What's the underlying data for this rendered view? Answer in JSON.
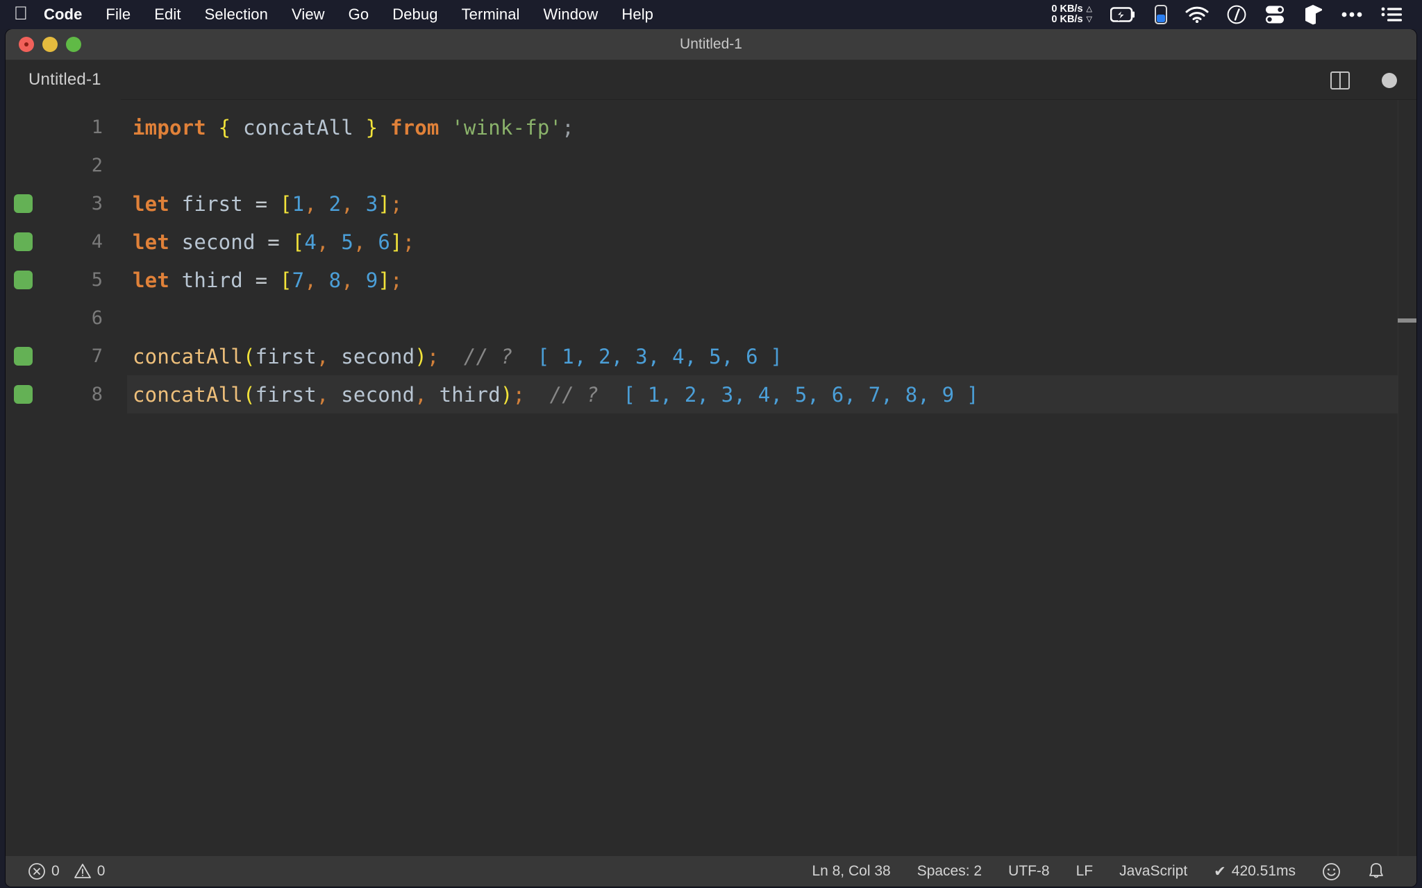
{
  "menubar": {
    "apple_icon": "apple-logo-icon",
    "items": [
      {
        "label": "Code",
        "bold": true
      },
      {
        "label": "File",
        "bold": false
      },
      {
        "label": "Edit",
        "bold": false
      },
      {
        "label": "Selection",
        "bold": false
      },
      {
        "label": "View",
        "bold": false
      },
      {
        "label": "Go",
        "bold": false
      },
      {
        "label": "Debug",
        "bold": false
      },
      {
        "label": "Terminal",
        "bold": false
      },
      {
        "label": "Window",
        "bold": false
      },
      {
        "label": "Help",
        "bold": false
      }
    ],
    "status_items": {
      "net_up": "0 KB/s",
      "net_down": "0 KB/s",
      "up_arrow": "△",
      "down_arrow": "▽",
      "icons": [
        "battery-charging-icon",
        "vertical-battery-indicator-icon",
        "wifi-icon",
        "gauge-icon",
        "toggles-icon",
        "cube-icon",
        "ellipsis-icon",
        "list-menu-icon"
      ]
    }
  },
  "window": {
    "title": "Untitled-1",
    "traffic_lights": [
      "close-button",
      "minimize-button",
      "maximize-button"
    ]
  },
  "tabbar": {
    "tabs": [
      {
        "label": "Untitled-1",
        "active": true,
        "dirty": true
      }
    ],
    "actions": [
      "split-editor-icon",
      "unsaved-indicator-dot"
    ]
  },
  "editor": {
    "lines": [
      {
        "number": "1",
        "marker": false,
        "active": false,
        "tokens": [
          {
            "t": "import",
            "c": "kw"
          },
          {
            "t": " ",
            "c": "op"
          },
          {
            "t": "{",
            "c": "brace"
          },
          {
            "t": " ",
            "c": "op"
          },
          {
            "t": "concatAll",
            "c": "ident"
          },
          {
            "t": " ",
            "c": "op"
          },
          {
            "t": "}",
            "c": "brace"
          },
          {
            "t": " ",
            "c": "op"
          },
          {
            "t": "from",
            "c": "kw"
          },
          {
            "t": " ",
            "c": "op"
          },
          {
            "t": "'wink-fp'",
            "c": "str"
          },
          {
            "t": ";",
            "c": "punc"
          }
        ]
      },
      {
        "number": "2",
        "marker": false,
        "active": false,
        "tokens": []
      },
      {
        "number": "3",
        "marker": true,
        "active": false,
        "tokens": [
          {
            "t": "let",
            "c": "kw"
          },
          {
            "t": " ",
            "c": "op"
          },
          {
            "t": "first",
            "c": "ident"
          },
          {
            "t": " ",
            "c": "op"
          },
          {
            "t": "=",
            "c": "op"
          },
          {
            "t": " ",
            "c": "op"
          },
          {
            "t": "[",
            "c": "brace"
          },
          {
            "t": "1",
            "c": "num"
          },
          {
            "t": ",",
            "c": "comma"
          },
          {
            "t": " ",
            "c": "op"
          },
          {
            "t": "2",
            "c": "num"
          },
          {
            "t": ",",
            "c": "comma"
          },
          {
            "t": " ",
            "c": "op"
          },
          {
            "t": "3",
            "c": "num"
          },
          {
            "t": "]",
            "c": "brace"
          },
          {
            "t": ";",
            "c": "semi"
          }
        ]
      },
      {
        "number": "4",
        "marker": true,
        "active": false,
        "tokens": [
          {
            "t": "let",
            "c": "kw"
          },
          {
            "t": " ",
            "c": "op"
          },
          {
            "t": "second",
            "c": "ident"
          },
          {
            "t": " ",
            "c": "op"
          },
          {
            "t": "=",
            "c": "op"
          },
          {
            "t": " ",
            "c": "op"
          },
          {
            "t": "[",
            "c": "brace"
          },
          {
            "t": "4",
            "c": "num"
          },
          {
            "t": ",",
            "c": "comma"
          },
          {
            "t": " ",
            "c": "op"
          },
          {
            "t": "5",
            "c": "num"
          },
          {
            "t": ",",
            "c": "comma"
          },
          {
            "t": " ",
            "c": "op"
          },
          {
            "t": "6",
            "c": "num"
          },
          {
            "t": "]",
            "c": "brace"
          },
          {
            "t": ";",
            "c": "semi"
          }
        ]
      },
      {
        "number": "5",
        "marker": true,
        "active": false,
        "tokens": [
          {
            "t": "let",
            "c": "kw"
          },
          {
            "t": " ",
            "c": "op"
          },
          {
            "t": "third",
            "c": "ident"
          },
          {
            "t": " ",
            "c": "op"
          },
          {
            "t": "=",
            "c": "op"
          },
          {
            "t": " ",
            "c": "op"
          },
          {
            "t": "[",
            "c": "brace"
          },
          {
            "t": "7",
            "c": "num"
          },
          {
            "t": ",",
            "c": "comma"
          },
          {
            "t": " ",
            "c": "op"
          },
          {
            "t": "8",
            "c": "num"
          },
          {
            "t": ",",
            "c": "comma"
          },
          {
            "t": " ",
            "c": "op"
          },
          {
            "t": "9",
            "c": "num"
          },
          {
            "t": "]",
            "c": "brace"
          },
          {
            "t": ";",
            "c": "semi"
          }
        ]
      },
      {
        "number": "6",
        "marker": false,
        "active": false,
        "tokens": []
      },
      {
        "number": "7",
        "marker": true,
        "active": false,
        "tokens": [
          {
            "t": "concatAll",
            "c": "fn"
          },
          {
            "t": "(",
            "c": "paren"
          },
          {
            "t": "first",
            "c": "ident"
          },
          {
            "t": ",",
            "c": "comma"
          },
          {
            "t": " ",
            "c": "op"
          },
          {
            "t": "second",
            "c": "ident"
          },
          {
            "t": ")",
            "c": "paren"
          },
          {
            "t": ";",
            "c": "semi"
          },
          {
            "t": "  ",
            "c": "op"
          },
          {
            "t": "// ?",
            "c": "comment"
          },
          {
            "t": "  ",
            "c": "op"
          },
          {
            "t": "[ 1, 2, 3, 4, 5, 6 ]",
            "c": "result"
          }
        ]
      },
      {
        "number": "8",
        "marker": true,
        "active": true,
        "tokens": [
          {
            "t": "concatAll",
            "c": "fn"
          },
          {
            "t": "(",
            "c": "paren"
          },
          {
            "t": "first",
            "c": "ident"
          },
          {
            "t": ",",
            "c": "comma"
          },
          {
            "t": " ",
            "c": "op"
          },
          {
            "t": "second",
            "c": "ident"
          },
          {
            "t": ",",
            "c": "comma"
          },
          {
            "t": " ",
            "c": "op"
          },
          {
            "t": "third",
            "c": "ident"
          },
          {
            "t": ")",
            "c": "paren"
          },
          {
            "t": ";",
            "c": "semi"
          },
          {
            "t": "  ",
            "c": "op"
          },
          {
            "t": "// ?",
            "c": "comment"
          },
          {
            "t": "  ",
            "c": "op"
          },
          {
            "t": "[ 1, 2, 3, 4, 5, 6, 7, 8, 9 ]",
            "c": "result"
          }
        ]
      }
    ]
  },
  "statusbar": {
    "errors": "0",
    "warnings": "0",
    "error_icon": "error-circle-icon",
    "warning_icon": "warning-triangle-icon",
    "cursor_position": "Ln 8, Col 38",
    "indentation": "Spaces: 2",
    "encoding": "UTF-8",
    "eol": "LF",
    "language": "JavaScript",
    "run_time": "420.51ms",
    "run_check": "✔",
    "feedback_icon": "smiley-icon",
    "bell_icon": "bell-icon"
  },
  "colors": {
    "menubar_bg": "#1b1d2b",
    "titlebar_bg": "#3c3c3c",
    "editor_bg": "#2b2b2b",
    "tab_bg": "#2a2a2a",
    "statusbar_bg": "#383838",
    "marker_green": "#64b155",
    "accent_blue": "#4b9fd8",
    "keyword_orange": "#e08139",
    "string_green": "#8bb36b",
    "brace_yellow": "#f2e33a",
    "fn_tan": "#efc07b"
  }
}
